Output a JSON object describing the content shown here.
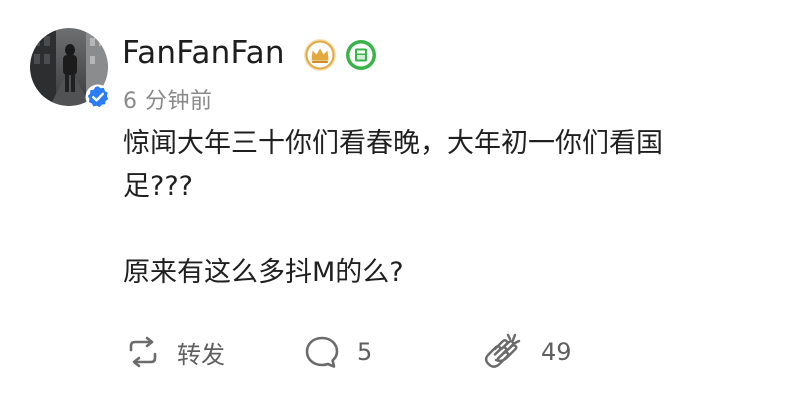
{
  "post": {
    "author": {
      "name": "FanFanFan"
    },
    "timestamp": "6 分钟前",
    "content": {
      "line1": "惊闻大年三十你们看春晚，大年初一你们看国",
      "line2": "足???",
      "line3": "原来有这么多抖M的么?"
    },
    "actions": {
      "repost_label": "转发",
      "comment_count": "5",
      "like_count": "49"
    }
  },
  "icons": {
    "verified": "verified-badge-icon",
    "crown_badge": "crown-badge-icon",
    "green_badge": "green-badge-icon",
    "repost": "repost-icon",
    "comment": "comment-icon",
    "like": "clap-icon"
  },
  "colors": {
    "verified_blue": "#2b7df5",
    "crown_gold": "#e2a93f",
    "badge_green": "#39b44a",
    "text_primary": "#1f1f1f",
    "text_secondary": "#8a8a8a",
    "icon_gray": "#6b6b6b"
  }
}
